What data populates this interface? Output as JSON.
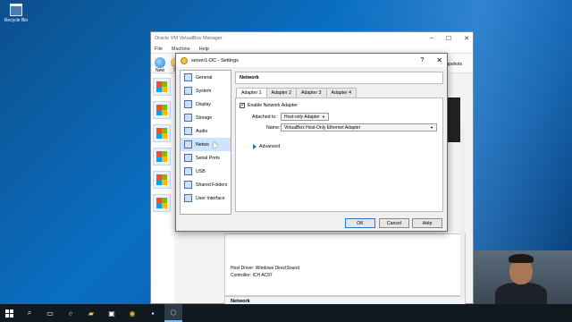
{
  "desktop": {
    "recycle_bin_label": "Recycle Bin"
  },
  "manager": {
    "title": "Oracle VM VirtualBox Manager",
    "menu": [
      "File",
      "Machine",
      "Help"
    ],
    "toolbar": {
      "new_label": "New",
      "se_label": "Se",
      "snapshots_label": "Snapshots"
    },
    "vm_items": [
      "W",
      "W",
      "se",
      "se",
      "se",
      "se"
    ],
    "audio": {
      "host_driver_label": "Host Driver:",
      "host_driver_value": "Windows DirectSound",
      "controller_label": "Controller:",
      "controller_value": "ICH AC97"
    },
    "network_section": "Network"
  },
  "dialog": {
    "title": "server1-DC - Settings",
    "help_glyph": "?",
    "close_glyph": "✕",
    "nav": [
      {
        "label": "General",
        "icon": "general-icon"
      },
      {
        "label": "System",
        "icon": "system-icon"
      },
      {
        "label": "Display",
        "icon": "display-icon"
      },
      {
        "label": "Storage",
        "icon": "storage-icon"
      },
      {
        "label": "Audio",
        "icon": "audio-icon"
      },
      {
        "label": "Netwo",
        "icon": "network-icon"
      },
      {
        "label": "Serial Ports",
        "icon": "serial-ports-icon"
      },
      {
        "label": "USB",
        "icon": "usb-icon"
      },
      {
        "label": "Shared Folders",
        "icon": "shared-folders-icon"
      },
      {
        "label": "User Interface",
        "icon": "user-interface-icon"
      }
    ],
    "selected_nav": "Network",
    "page_title": "Network",
    "tabs": [
      "Adapter 1",
      "Adapter 2",
      "Adapter 3",
      "Adapter 4"
    ],
    "active_tab": "Adapter 1",
    "enable_adapter_label": "Enable Network Adapter",
    "enable_adapter_checked": true,
    "attached_to_label": "Attached to:",
    "attached_to_value": "Host-only Adapter",
    "name_label": "Name:",
    "name_value": "VirtualBox Host-Only Ethernet Adapter",
    "advanced_label": "Advanced",
    "buttons": {
      "ok": "OK",
      "cancel": "Cancel",
      "help": "Help"
    }
  },
  "taskbar": {
    "icons": [
      "start-icon",
      "search-icon",
      "task-view-icon",
      "edge-icon",
      "file-explorer-icon",
      "store-icon",
      "chrome-icon",
      "terminal-icon",
      "virtualbox-icon"
    ]
  },
  "colors": {
    "desktop": "#0a6fc2",
    "selection": "#cde4fa",
    "taskbar": "#101820",
    "default_button_border": "#2a76c6"
  }
}
